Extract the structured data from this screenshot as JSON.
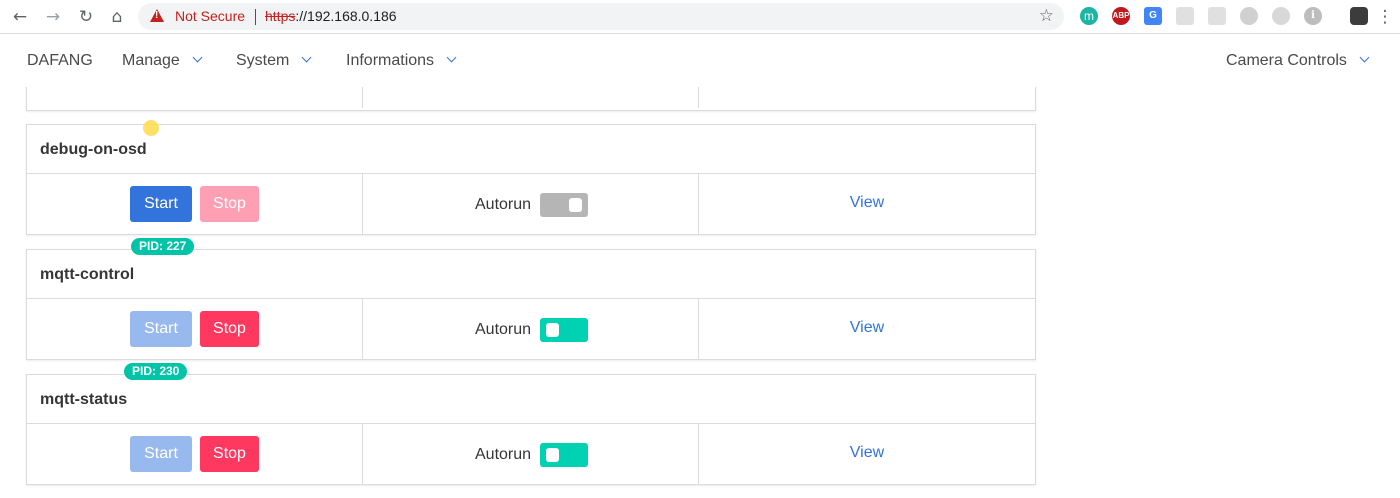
{
  "browser": {
    "not_secure": "Not Secure",
    "url_scheme": "https",
    "url_rest": "://192.168.0.186",
    "ext_abp": "ABP"
  },
  "navbar": {
    "brand": "DAFANG",
    "items": [
      "Manage",
      "System",
      "Informations"
    ],
    "right": "Camera Controls"
  },
  "labels": {
    "start": "Start",
    "stop": "Stop",
    "autorun": "Autorun",
    "view": "View"
  },
  "services": [
    {
      "name": "debug-on-osd",
      "pid": "",
      "running": false,
      "autorun": false
    },
    {
      "name": "mqtt-control",
      "pid": "PID: 227",
      "running": true,
      "autorun": true
    },
    {
      "name": "mqtt-status",
      "pid": "PID: 230",
      "running": true,
      "autorun": true
    }
  ],
  "colors": {
    "primary": "#3273dc",
    "danger": "#ff3860",
    "success": "#00d1b2",
    "pid_badge": "#00c4a7"
  }
}
